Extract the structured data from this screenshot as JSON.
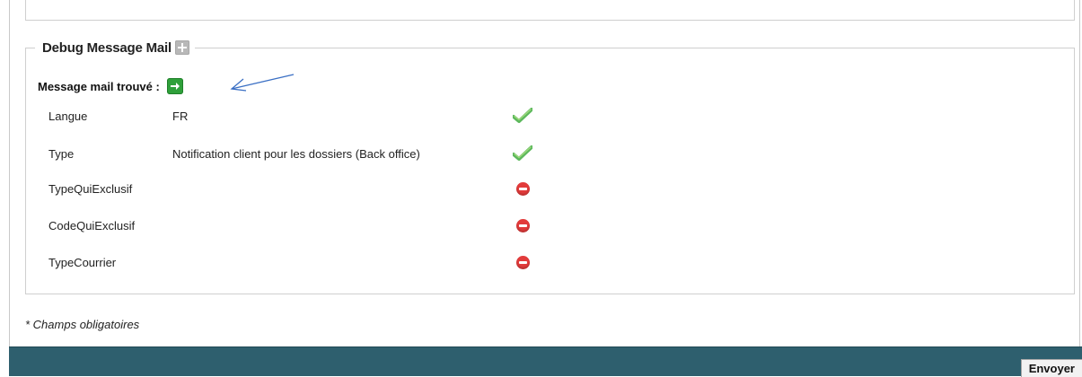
{
  "section": {
    "title": "Debug Message Mail",
    "found_label": "Message mail trouvé :"
  },
  "fields": [
    {
      "label": "Langue",
      "value": "FR",
      "status": "ok"
    },
    {
      "label": "Type",
      "value": "Notification client pour les dossiers (Back office)",
      "status": "ok"
    },
    {
      "label": "TypeQuiExclusif",
      "value": "",
      "status": "error"
    },
    {
      "label": "CodeQuiExclusif",
      "value": "",
      "status": "error"
    },
    {
      "label": "TypeCourrier",
      "value": "",
      "status": "error"
    }
  ],
  "footer": {
    "mandatory_note": "* Champs obligatoires",
    "send_label": "Envoyer"
  },
  "colors": {
    "footer_bar": "#2e5f6e",
    "ok_icon": "#5cb85c",
    "error_icon": "#e23b3b",
    "go_icon": "#2fa03a",
    "annotation_arrow": "#3a6fc4"
  },
  "icons": {
    "expand": "plus-icon",
    "go": "arrow-right-icon",
    "ok": "check-icon",
    "error": "stop-icon"
  }
}
